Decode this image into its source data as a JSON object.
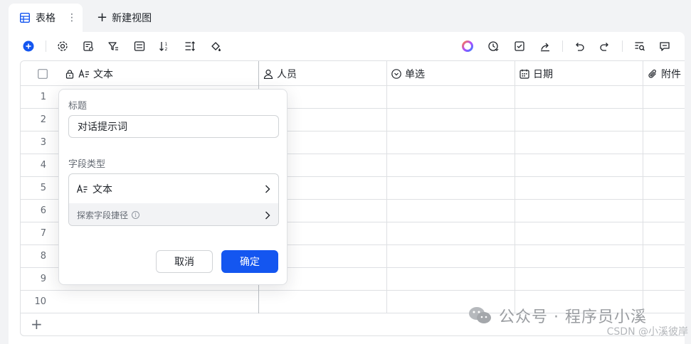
{
  "tabs": {
    "active_label": "表格",
    "more_glyph": "⋮",
    "new_view_label": "新建视图"
  },
  "columns": [
    {
      "label": "文本",
      "icon": "text-icon"
    },
    {
      "label": "人员",
      "icon": "person-icon"
    },
    {
      "label": "单选",
      "icon": "single-select-icon"
    },
    {
      "label": "日期",
      "icon": "calendar-icon"
    },
    {
      "label": "附件",
      "icon": "attachment-icon"
    }
  ],
  "rows": [
    "1",
    "2",
    "3",
    "4",
    "5",
    "6",
    "7",
    "8",
    "9",
    "10"
  ],
  "popup": {
    "title_label": "标题",
    "title_value": "对话提示词",
    "field_type_label": "字段类型",
    "field_type_value": "文本",
    "explore_label": "探索字段捷径",
    "info_glyph": "i",
    "cancel_label": "取消",
    "confirm_label": "确定"
  },
  "watermark": {
    "wechat_text": "公众号 · 程序员小溪",
    "csdn_text": "CSDN @小溪彼岸"
  },
  "colors": {
    "accent": "#1456f0",
    "border": "#dee0e3",
    "muted_text": "#646a73",
    "page_bg": "#f2f3f5"
  }
}
